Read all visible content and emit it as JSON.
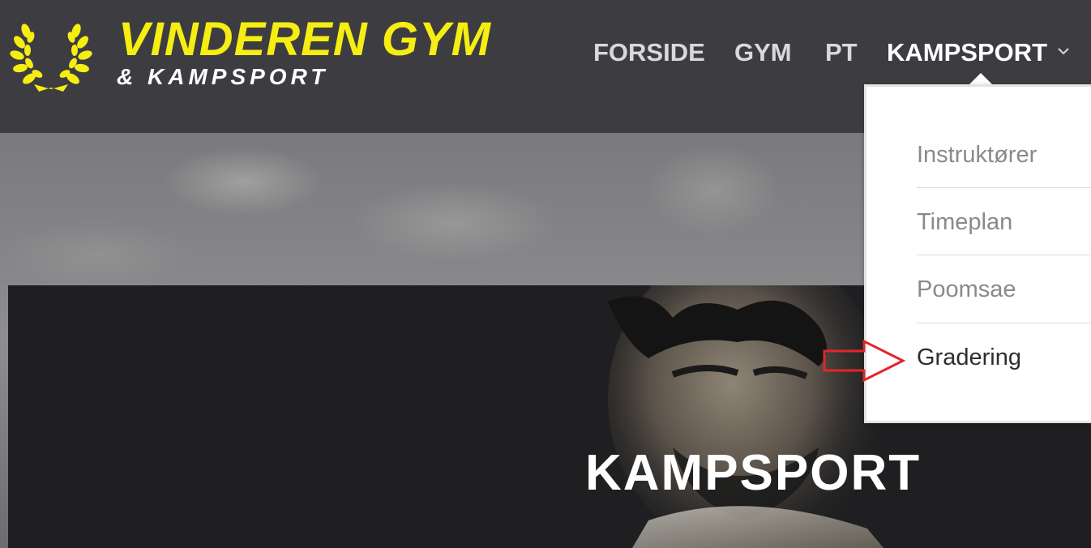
{
  "brand": {
    "name": "VINDEREN GYM",
    "subtitle": "& KAMPSPORT",
    "accent_color": "#f6ee13",
    "logo_icon": "laurel-wreath-icon"
  },
  "nav": {
    "items": [
      {
        "label": "FORSIDE"
      },
      {
        "label": "GYM"
      },
      {
        "label": "PT"
      },
      {
        "label": "KAMPSPORT",
        "has_dropdown": true,
        "active": true
      }
    ],
    "dropdown_icon": "chevron-down-icon"
  },
  "dropdown": {
    "items": [
      {
        "label": "Instruktører"
      },
      {
        "label": "Timeplan"
      },
      {
        "label": "Poomsae"
      },
      {
        "label": "Gradering",
        "highlighted": true
      }
    ]
  },
  "hero": {
    "title": "KAMPSPORT"
  },
  "annotation": {
    "arrow_icon": "red-outline-arrow-icon",
    "color": "#e3242b"
  }
}
